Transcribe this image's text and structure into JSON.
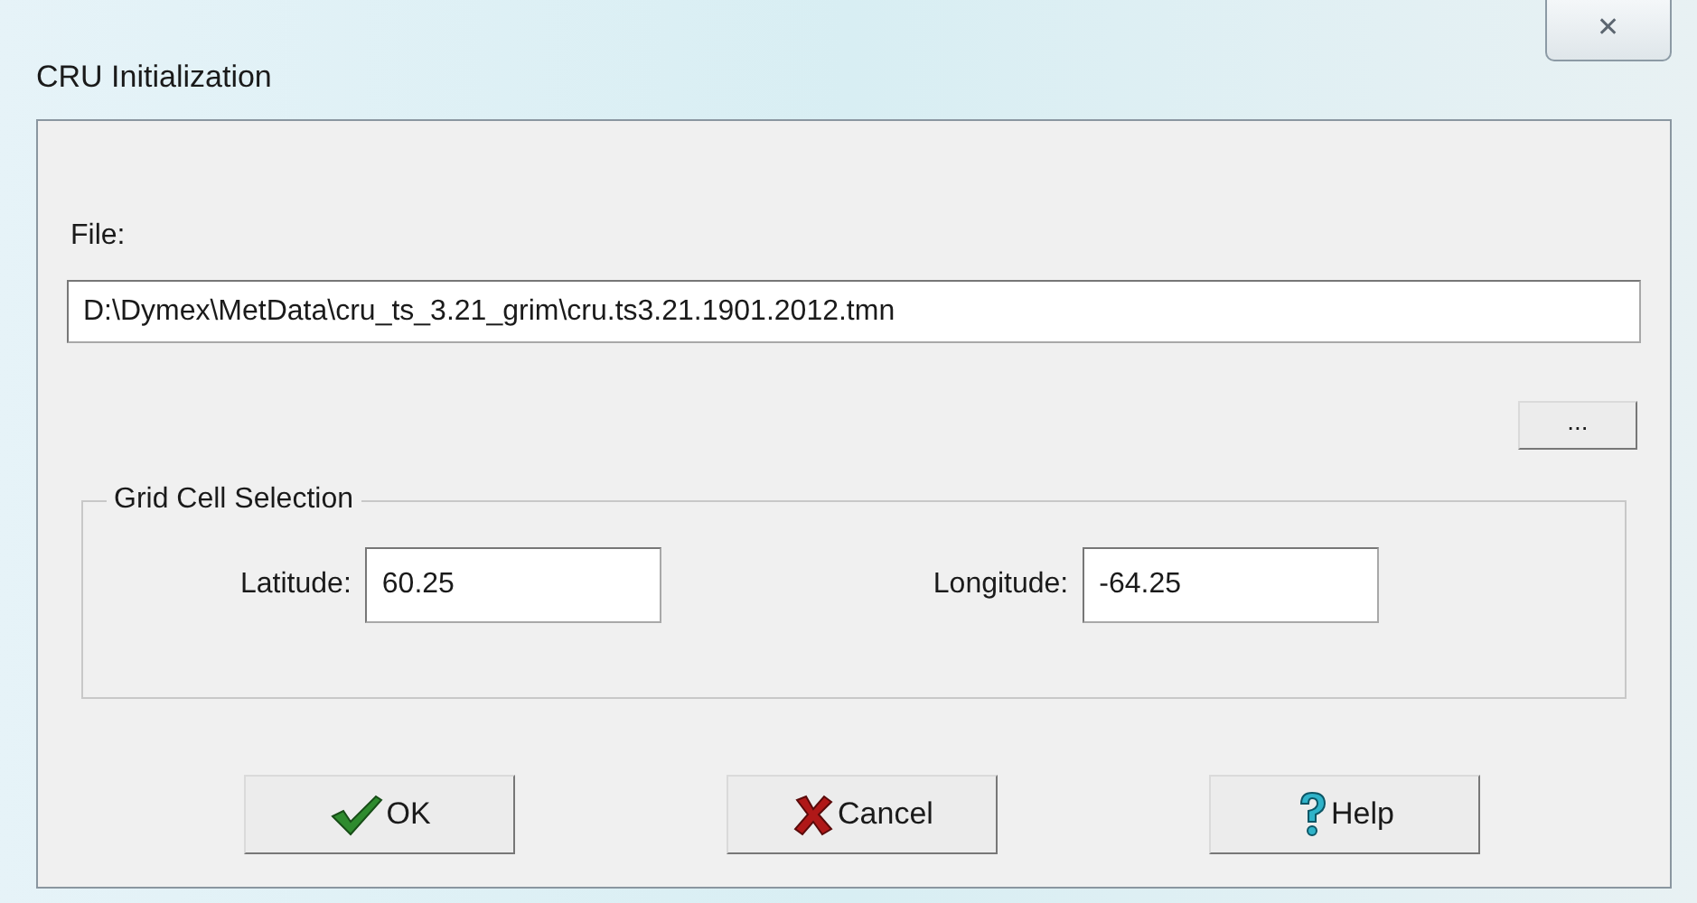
{
  "window": {
    "title": "CRU Initialization",
    "close": "✕"
  },
  "file": {
    "label": "File:",
    "value": "D:\\Dymex\\MetData\\cru_ts_3.21_grim\\cru.ts3.21.1901.2012.tmn",
    "browse": "..."
  },
  "grid_cell_selection": {
    "title": "Grid Cell Selection",
    "fields": [
      {
        "label": "Latitude:",
        "value": "60.25"
      },
      {
        "label": "Longitude:",
        "value": "-64.25"
      }
    ]
  },
  "buttons": [
    {
      "kind": "ok",
      "label": "OK"
    },
    {
      "kind": "cancel",
      "label": "Cancel"
    },
    {
      "kind": "help",
      "label": "Help"
    }
  ]
}
